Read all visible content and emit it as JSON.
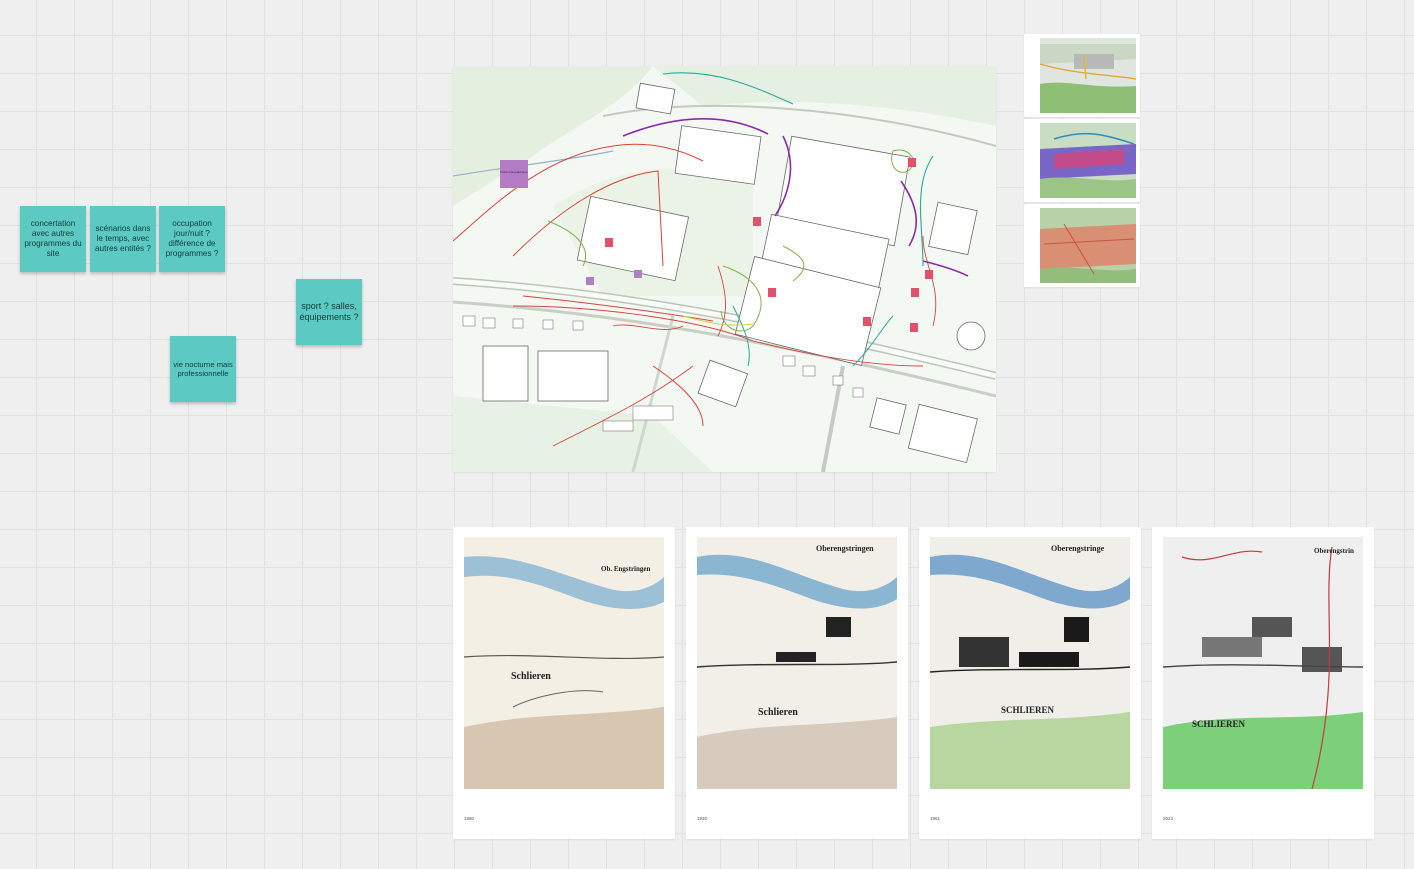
{
  "board": {
    "sticky_notes": [
      {
        "id": "concertation",
        "text": "concertation avec autres programmes du site"
      },
      {
        "id": "scenarios",
        "text": "scénarios dans le temps, avec autres entités ?"
      },
      {
        "id": "occupation",
        "text": "occupation jour/nuit ? différence de programmes ?"
      },
      {
        "id": "sport",
        "text": "sport ? salles, équipements ?"
      },
      {
        "id": "vie-nocturne",
        "text": "vie nocturne mais professionnelle"
      }
    ],
    "site_plan": {
      "annotation_note": "limite topographique"
    },
    "historical_maps": [
      {
        "year": "1880",
        "place": "Schlieren",
        "north_label": "Ob. Engstringen"
      },
      {
        "year": "1930",
        "place": "Schlieren",
        "north_label": "Oberengstringen"
      },
      {
        "year": "1961",
        "place": "SCHLIEREN",
        "north_label": "Oberengstringe"
      },
      {
        "year": "2023",
        "place": "SCHLIEREN",
        "north_label": "Oberengstrin"
      }
    ]
  },
  "colors": {
    "sticky_teal": "#5ccac2",
    "note_purple": "#b57cc6",
    "marker_red": "#e0526a",
    "annotation_red": "#d9443a",
    "annotation_purple": "#8a2aa8",
    "annotation_teal": "#27a99b",
    "annotation_green": "#7fb34a"
  }
}
